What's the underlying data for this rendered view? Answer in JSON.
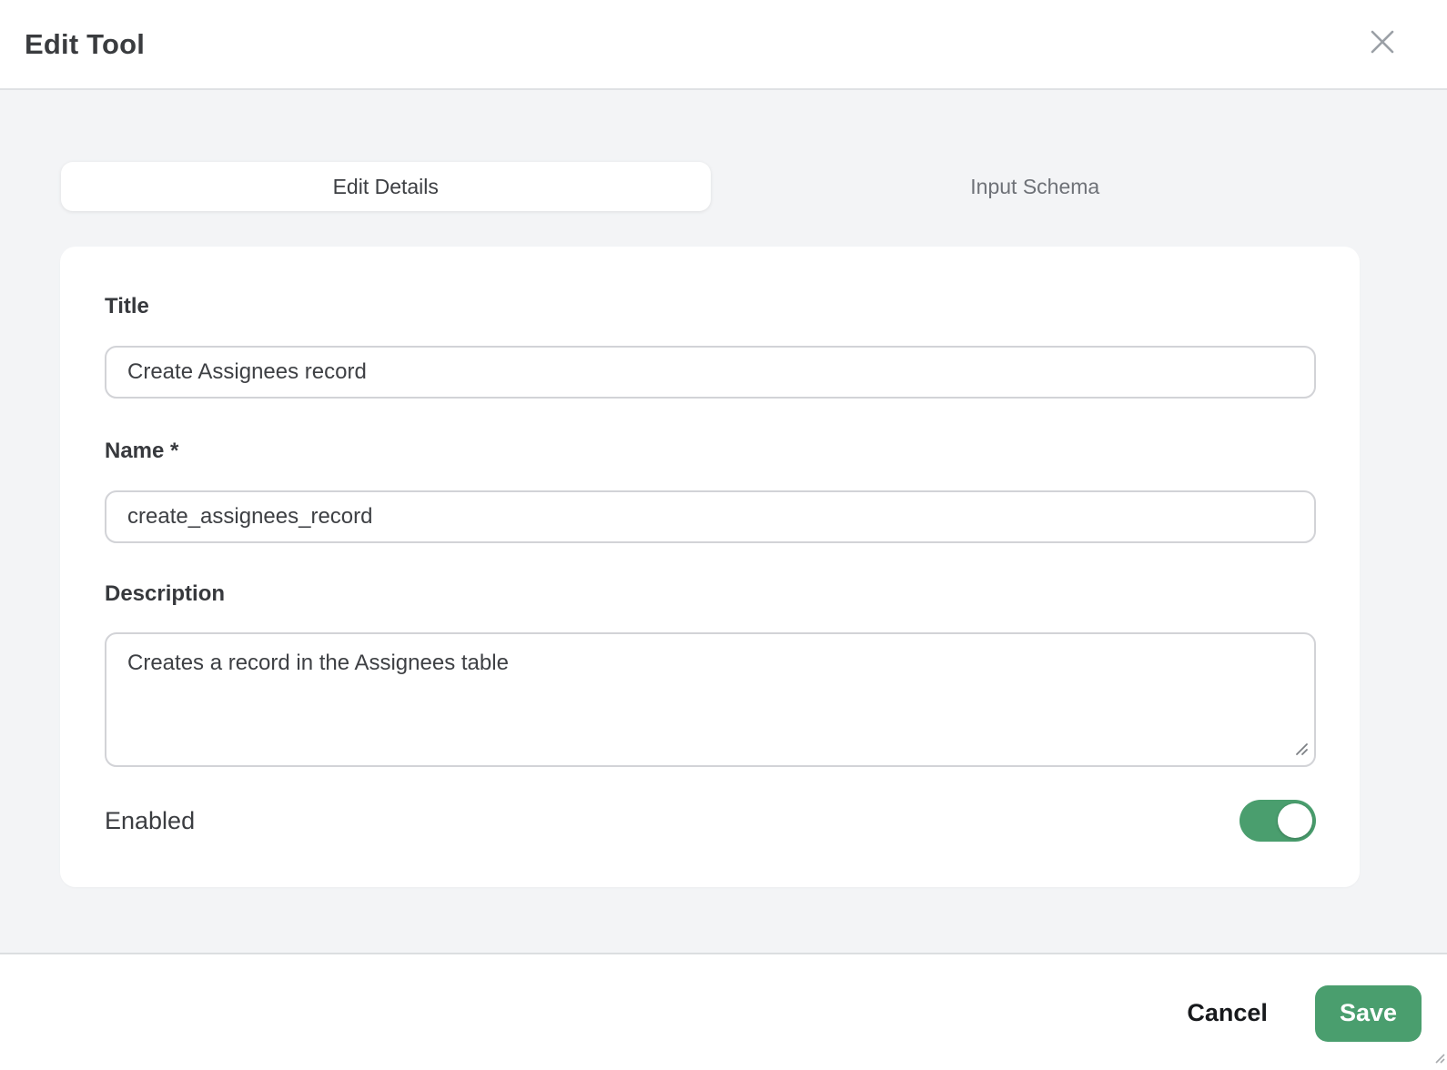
{
  "modal": {
    "title": "Edit Tool"
  },
  "tabs": [
    {
      "label": "Edit Details",
      "active": true
    },
    {
      "label": "Input Schema",
      "active": false
    }
  ],
  "form": {
    "title": {
      "label": "Title",
      "value": "Create Assignees record"
    },
    "name": {
      "label": "Name *",
      "value": "create_assignees_record"
    },
    "description": {
      "label": "Description",
      "value": "Creates a record in the Assignees table"
    },
    "enabled": {
      "label": "Enabled",
      "state": "on"
    }
  },
  "footer": {
    "cancel_label": "Cancel",
    "save_label": "Save"
  },
  "icons": {
    "close": "close-icon",
    "textarea_resize": "resize-grip-icon"
  },
  "colors": {
    "accent_green": "#4a9e6e",
    "body_background": "#f3f4f6",
    "divider": "#dfe1e4",
    "input_border": "#d2d3d7",
    "text_primary": "#3a3c3f",
    "text_secondary": "#6e7177"
  }
}
